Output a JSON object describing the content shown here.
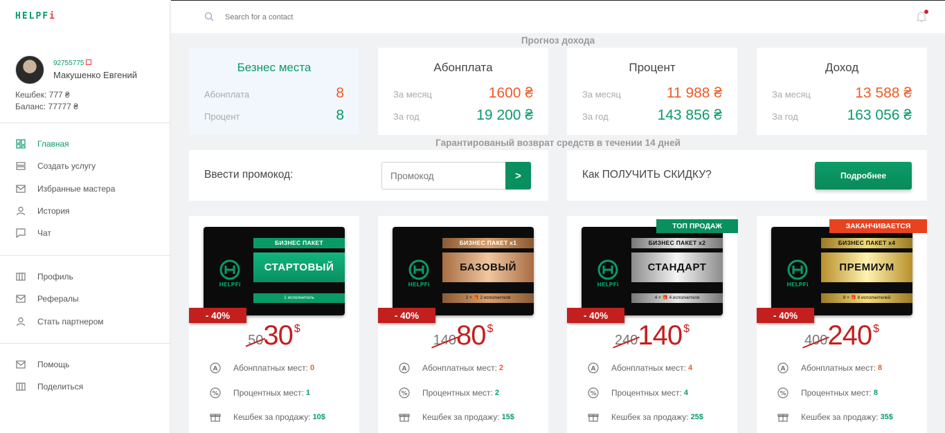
{
  "logo": {
    "main": "HELPF",
    "accent": "i"
  },
  "profile": {
    "id": "92755775",
    "name": "Макушенко Евгений",
    "cashback_label": "Кешбек:",
    "cashback_value": "777 ₴",
    "balance_label": "Баланс:",
    "balance_value": "77777 ₴"
  },
  "menu_main": [
    {
      "label": "Главная",
      "icon": "dashboard-icon"
    },
    {
      "label": "Создать услугу",
      "icon": "service-icon"
    },
    {
      "label": "Избранные мастера",
      "icon": "mail-icon"
    },
    {
      "label": "История",
      "icon": "user-icon"
    },
    {
      "label": "Чат",
      "icon": "chat-icon"
    }
  ],
  "menu_account": [
    {
      "label": "Профиль",
      "icon": "columns-icon"
    },
    {
      "label": "Рефералы",
      "icon": "mail-icon"
    },
    {
      "label": "Стать партнером",
      "icon": "user-icon"
    }
  ],
  "menu_help": [
    {
      "label": "Помощь",
      "icon": "mail-icon"
    },
    {
      "label": "Поделиться",
      "icon": "columns-icon"
    }
  ],
  "search": {
    "placeholder": "Search for a contact"
  },
  "forecast_title": "Прогноз дохода",
  "stats": [
    {
      "title": "Безнес места",
      "row1_label": "Абонплата",
      "row1_value": "8",
      "row2_label": "Процент",
      "row2_value": "8"
    },
    {
      "title": "Абонплата",
      "row1_label": "За месяц",
      "row1_value": "1600 ₴",
      "row2_label": "За год",
      "row2_value": "19 200 ₴"
    },
    {
      "title": "Процент",
      "row1_label": "За месяц",
      "row1_value": "11 988 ₴",
      "row2_label": "За год",
      "row2_value": "143 856 ₴"
    },
    {
      "title": "Доход",
      "row1_label": "За месяц",
      "row1_value": "13 588 ₴",
      "row2_label": "За год",
      "row2_value": "163 056 ₴"
    }
  ],
  "guarantee": "Гарантированый возврат средств в течении 14 дней",
  "promo": {
    "label": "Ввести промокод:",
    "placeholder": "Промокод",
    "submit": ">"
  },
  "discount": {
    "label": "Как ПОЛУЧИТЬ СКИДКУ?",
    "button": "Подробнее"
  },
  "colors": {
    "green": "#0a9a66",
    "orange": "#ef5a28",
    "red": "#c31f1f"
  },
  "packages": [
    {
      "strip_top": "БИЗНЕС ПАКЕТ",
      "name": "СТАРТОВЫЙ",
      "strip_bottom": "1 исполнитель",
      "tag": "",
      "discount": "- 40%",
      "old_price": "50",
      "new_price": "30",
      "currency": "$",
      "f1_label": "Абонплатных мест:",
      "f1_value": "0",
      "f2_label": "Процентных мест:",
      "f2_value": "1",
      "f3_label": "Кешбек за продажу:",
      "f3_value": "10$"
    },
    {
      "strip_top": "БИЗНЕС ПАКЕТ x1",
      "name": "БАЗОВЫЙ",
      "strip_bottom": "2 + 🎁 2 исполнителя",
      "tag": "",
      "discount": "- 40%",
      "old_price": "140",
      "new_price": "80",
      "currency": "$",
      "f1_label": "Абонплатных мест:",
      "f1_value": "2",
      "f2_label": "Процентных мест:",
      "f2_value": "2",
      "f3_label": "Кешбек за продажу:",
      "f3_value": "15$"
    },
    {
      "strip_top": "БИЗНЕС ПАКЕТ x2",
      "name": "СТАНДАРТ",
      "strip_bottom": "4 + 🎁 4 исполнителя",
      "tag": "ТОП ПРОДАЖ",
      "discount": "- 40%",
      "old_price": "240",
      "new_price": "140",
      "currency": "$",
      "f1_label": "Абонплатных мест:",
      "f1_value": "4",
      "f2_label": "Процентных мест:",
      "f2_value": "4",
      "f3_label": "Кешбек за продажу:",
      "f3_value": "25$"
    },
    {
      "strip_top": "БИЗНЕС ПАКЕТ x4",
      "name": "ПРЕМИУМ",
      "strip_bottom": "8 + 🎁 8 исполнителей",
      "tag": "ЗАКАНЧИВАЕТСЯ",
      "discount": "- 40%",
      "old_price": "400",
      "new_price": "240",
      "currency": "$",
      "f1_label": "Абонплатных мест:",
      "f1_value": "8",
      "f2_label": "Процентных мест:",
      "f2_value": "8",
      "f3_label": "Кешбек за продажу:",
      "f3_value": "35$"
    }
  ]
}
